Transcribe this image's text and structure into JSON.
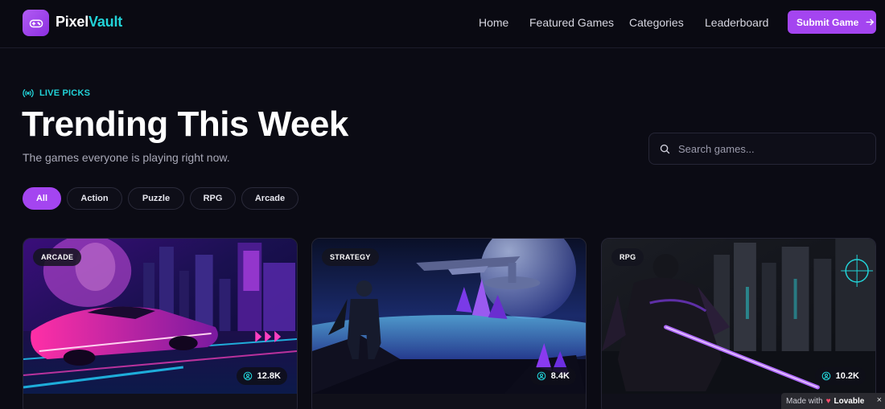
{
  "brand": {
    "name_part1": "Pixel",
    "name_part2": "Vault"
  },
  "nav": {
    "home": "Home",
    "featured": "Featured Games",
    "categories": "Categories",
    "leaderboard": "Leaderboard",
    "submit": "Submit Game"
  },
  "hero": {
    "eyebrow": "LIVE PICKS",
    "title": "Trending This Week",
    "subtitle": "The games everyone is playing right now."
  },
  "search": {
    "placeholder": "Search games..."
  },
  "filters": [
    "All",
    "Action",
    "Puzzle",
    "RPG",
    "Arcade"
  ],
  "active_filter": "All",
  "cards": [
    {
      "badge": "ARCADE",
      "plays": "12.8K"
    },
    {
      "badge": "STRATEGY",
      "plays": "8.4K"
    },
    {
      "badge": "RPG",
      "plays": "10.2K"
    }
  ],
  "footer_badge": {
    "made_with": "Made with",
    "brand": "Lovable",
    "close": "×"
  },
  "colors": {
    "accent": "#a445f0",
    "cyan": "#22d3d8",
    "background": "#0b0b14"
  }
}
